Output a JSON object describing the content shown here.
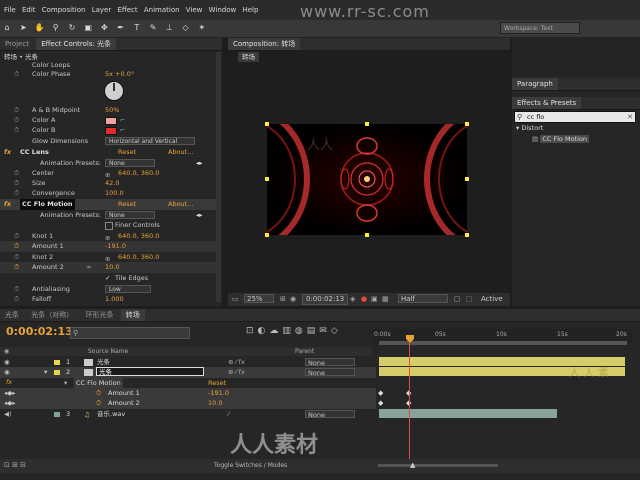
{
  "menu": [
    "File",
    "Edit",
    "Composition",
    "Layer",
    "Effect",
    "Animation",
    "View",
    "Window",
    "Help"
  ],
  "watermark_url": "www.rr-sc.com",
  "workspace_label": "Workspace:",
  "workspace_value": "Text",
  "left_tabs": {
    "project": "Project",
    "effect_controls": "Effect Controls: 光条"
  },
  "breadcrumb": "转场 • 光条",
  "effect_props": {
    "color_loops": "Color Loops",
    "color_phase": "Color Phase",
    "color_phase_val": "5x +0.0°",
    "ab_midpoint": "A & B Midpoint",
    "ab_midpoint_val": "50%",
    "color_a": "Color A",
    "color_b": "Color B",
    "glow_dimensions": "Glow Dimensions",
    "glow_dimensions_val": "Horizontal and Vertical",
    "fx1_name": "CC Lens",
    "reset": "Reset",
    "about": "About...",
    "animation_presets": "Animation Presets:",
    "presets_val": "None",
    "center": "Center",
    "center_val": "640.0, 360.0",
    "size": "Size",
    "size_val": "42.0",
    "convergence": "Convergence",
    "convergence_val": "100.0",
    "fx2_name": "CC Flo Motion",
    "finer_controls": "Finer Controls",
    "knot1": "Knot 1",
    "knot1_val": "640.0, 360.0",
    "amount1": "Amount 1",
    "amount1_val": "-191.0",
    "knot2": "Knot 2",
    "knot2_val": "640.0, 360.0",
    "amount2": "Amount 2",
    "amount2_val": "10.0",
    "tile_edges": "Tile Edges",
    "antialiasing": "Antialiasing",
    "antialiasing_val": "Low",
    "falloff": "Falloff",
    "falloff_val": "1.000"
  },
  "comp": {
    "tab": "Composition: 转场",
    "name_tab": "转场",
    "zoom": "25%",
    "timecode": "0:00:02:13",
    "resolution": "Half",
    "view": "Active"
  },
  "right": {
    "paragraph": "Paragraph",
    "effects_presets": "Effects & Presets",
    "search_value": "cc flo",
    "category": "Distort",
    "result": "CC Flo Motion"
  },
  "timeline": {
    "tabs": [
      "光条",
      "光条（对称）",
      "环形光条",
      "转场"
    ],
    "timecode": "0:00:02:13",
    "col_source": "Source Name",
    "col_parent": "Parent",
    "layers": [
      {
        "num": "1",
        "name": "光条",
        "parent": "None"
      },
      {
        "num": "2",
        "name": "光条",
        "parent": "None"
      },
      {
        "num": "3",
        "name": "音乐.wav",
        "parent": "None"
      }
    ],
    "fx_label": "fx",
    "effect_name": "CC Flo Motion",
    "reset": "Reset",
    "amount1_label": "Amount 1",
    "amount1_value": "-191.0",
    "amount2_label": "Amount 2",
    "amount2_value": "10.0",
    "ruler": [
      "0:00s",
      "05s",
      "10s",
      "15s",
      "20s"
    ],
    "toggle_label": "Toggle Switches / Modes"
  },
  "colors": {
    "accent": "#e8a236",
    "layer_bar": "#d6cd6a",
    "audio_bar": "#88a49a",
    "playhead": "#e84a3a",
    "color_a": "#f3a2a2",
    "color_b": "#e62a2a"
  }
}
